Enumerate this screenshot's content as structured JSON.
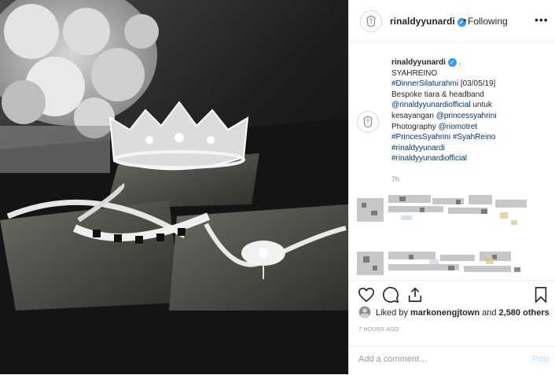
{
  "post": {
    "username": "rinaldyyunardi",
    "dot": "•",
    "follow_status": "Following",
    "more_label": "•••"
  },
  "caption": {
    "username": "rinaldyyunardi",
    "after_name": " .",
    "line_title": "SYAHREINO",
    "hashtag_event": "#DinnerSilaturahmi",
    "event_date": " [03/05/19]",
    "line_bespoke": "Bespoke tiara & headband",
    "mention_official": "@rinaldyyunardiofficial",
    "for_word": " untuk",
    "kesayangan_word": "kesayangan ",
    "mention_princess": "@princessyahrini",
    "photography_word": "Photography ",
    "mention_photo": "@riomotret",
    "hashtag_1": "#PrincesSyahrini",
    "hashtag_2": "#SyahReino",
    "hashtag_3": "#rinaldyyunardi",
    "hashtag_4": "#rinaldyyunardiofficial",
    "time": "7h"
  },
  "likes": {
    "prefix": "Liked by ",
    "user": "markonengjtown",
    "middle": " and ",
    "count": "2,580 others"
  },
  "time_ago": "7 HOURS AGO",
  "comment_box": {
    "placeholder": "Add a comment…",
    "post_label": "Post"
  },
  "icons": {
    "like": "heart-icon",
    "comment": "comment-icon",
    "share": "share-icon",
    "save": "bookmark-icon",
    "verified": "verified-badge-icon",
    "more": "more-options-icon"
  },
  "colors": {
    "link": "#003569",
    "verified": "#3897f0",
    "muted": "#8e8e8e",
    "post_disabled": "#b2dffc"
  }
}
